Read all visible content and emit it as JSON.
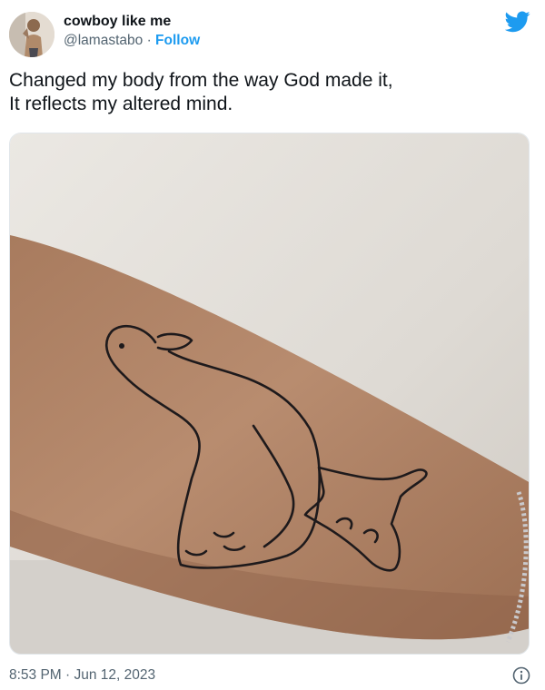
{
  "tweet": {
    "author": {
      "display_name": "cowboy like me",
      "handle": "@lamastabo",
      "separator": "·",
      "follow_label": "Follow"
    },
    "text": "Changed my body from the way God made it,\nIt reflects my altered mind.",
    "timestamp": "8:53 PM · Jun 12, 2023",
    "media": {
      "kind": "photo",
      "subject": "forearm tattoo"
    }
  },
  "icons": {
    "brand": "twitter-bird-icon",
    "info": "info-icon"
  },
  "colors": {
    "accent": "#1d9bf0",
    "text": "#0f1419",
    "secondary_text": "#536471"
  }
}
